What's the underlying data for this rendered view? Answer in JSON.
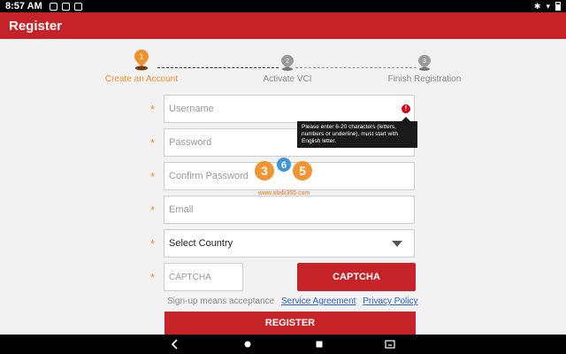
{
  "status_bar": {
    "time": "8:57 AM"
  },
  "app_bar": {
    "title": "Register"
  },
  "steps": [
    {
      "number": "1",
      "label": "Create an Account"
    },
    {
      "number": "2",
      "label": "Activate VCI"
    },
    {
      "number": "3",
      "label": "Finish Registration"
    }
  ],
  "form": {
    "required_mark": "*",
    "username_placeholder": "Username",
    "password_placeholder": "Password",
    "confirm_password_placeholder": "Confirm Password",
    "email_placeholder": "Email",
    "country_select": "Select Country",
    "captcha_placeholder": "CAPTCHA",
    "captcha_button": "CAPTCHA"
  },
  "tooltip": {
    "text": "Please enter 6-20 characters (letters, numbers or underline), must start with English letter."
  },
  "terms": {
    "prefix": "Sign-up means acceptance",
    "service_agreement": "Service Agreement",
    "privacy_policy": "Privacy Policy"
  },
  "register_button": "REGISTER",
  "watermark": {
    "logo_text": "365",
    "url": "www.obdii365.com"
  },
  "colors": {
    "primary": "#c62329",
    "accent": "#f0902a",
    "link": "#2a63c9"
  }
}
